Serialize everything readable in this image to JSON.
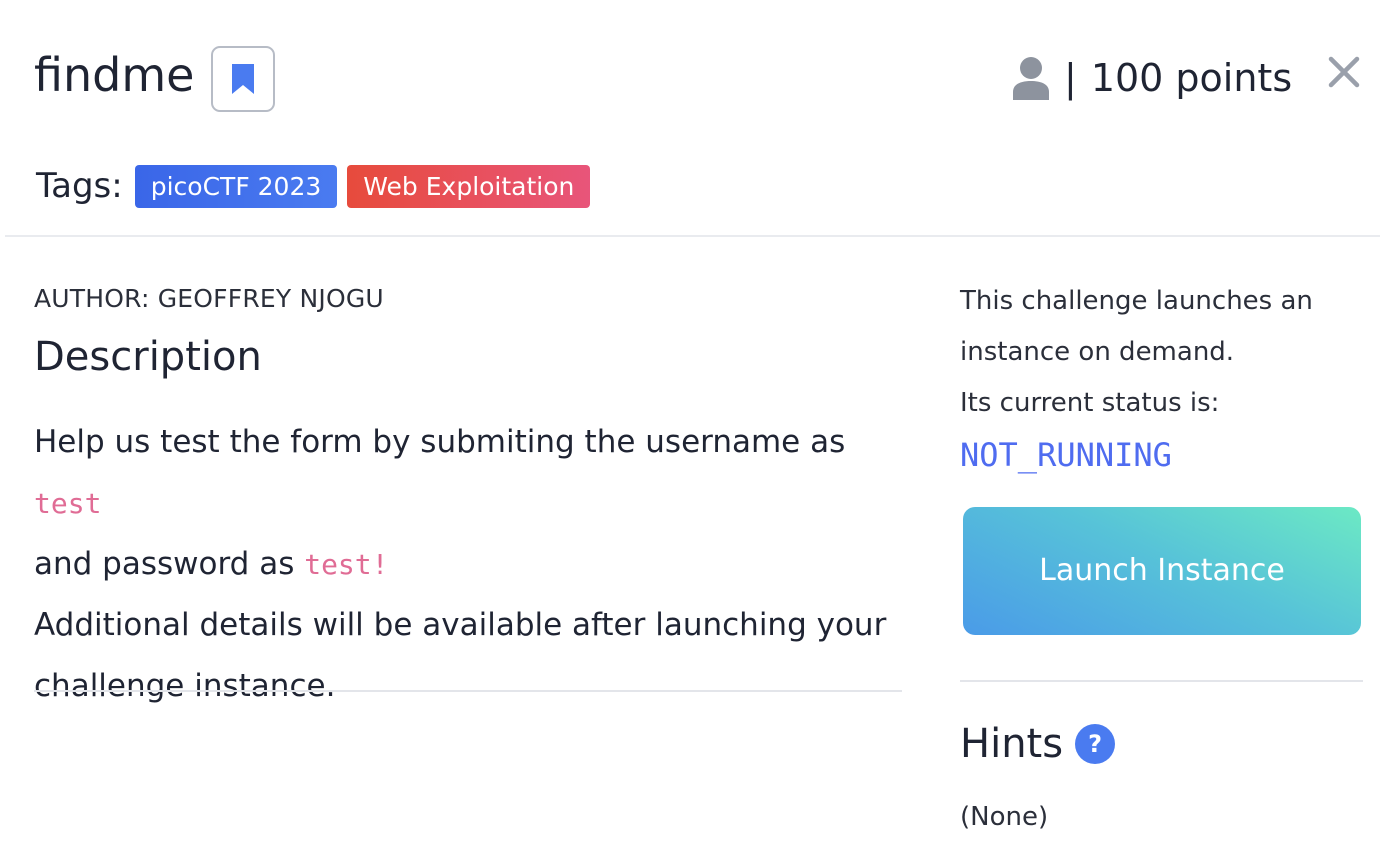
{
  "challenge": {
    "title": "findme",
    "points_separator": "|",
    "points_label": "100 points"
  },
  "tags": {
    "label": "Tags:",
    "items": [
      {
        "text": "picoCTF 2023",
        "color": "#3a66e8"
      },
      {
        "text": "Web Exploitation",
        "color": "#e74b3c"
      }
    ]
  },
  "description": {
    "author": "AUTHOR: GEOFFREY NJOGU",
    "heading": "Description",
    "text_part1": "Help us test the form by submiting the username as ",
    "code_username": "test",
    "text_part2": " and password as ",
    "code_password": "test!",
    "text_part3": "Additional details will be available after launching your challenge instance."
  },
  "instance": {
    "line1": "This challenge launches an instance on demand.",
    "line2": "Its current status is:",
    "status": "NOT_RUNNING",
    "launch_label": "Launch Instance"
  },
  "hints": {
    "heading": "Hints",
    "help_glyph": "?",
    "none_text": "(None)"
  },
  "icons": {
    "bookmark": "bookmark-icon",
    "user": "user-icon",
    "close": "close-icon",
    "help": "question-circle-icon"
  },
  "colors": {
    "accent_blue": "#4a7bf0",
    "status_text": "#4f6cf0",
    "code_text": "#e06c95",
    "tag_blue": "#3a66e8",
    "tag_red": "#e74b3c"
  }
}
